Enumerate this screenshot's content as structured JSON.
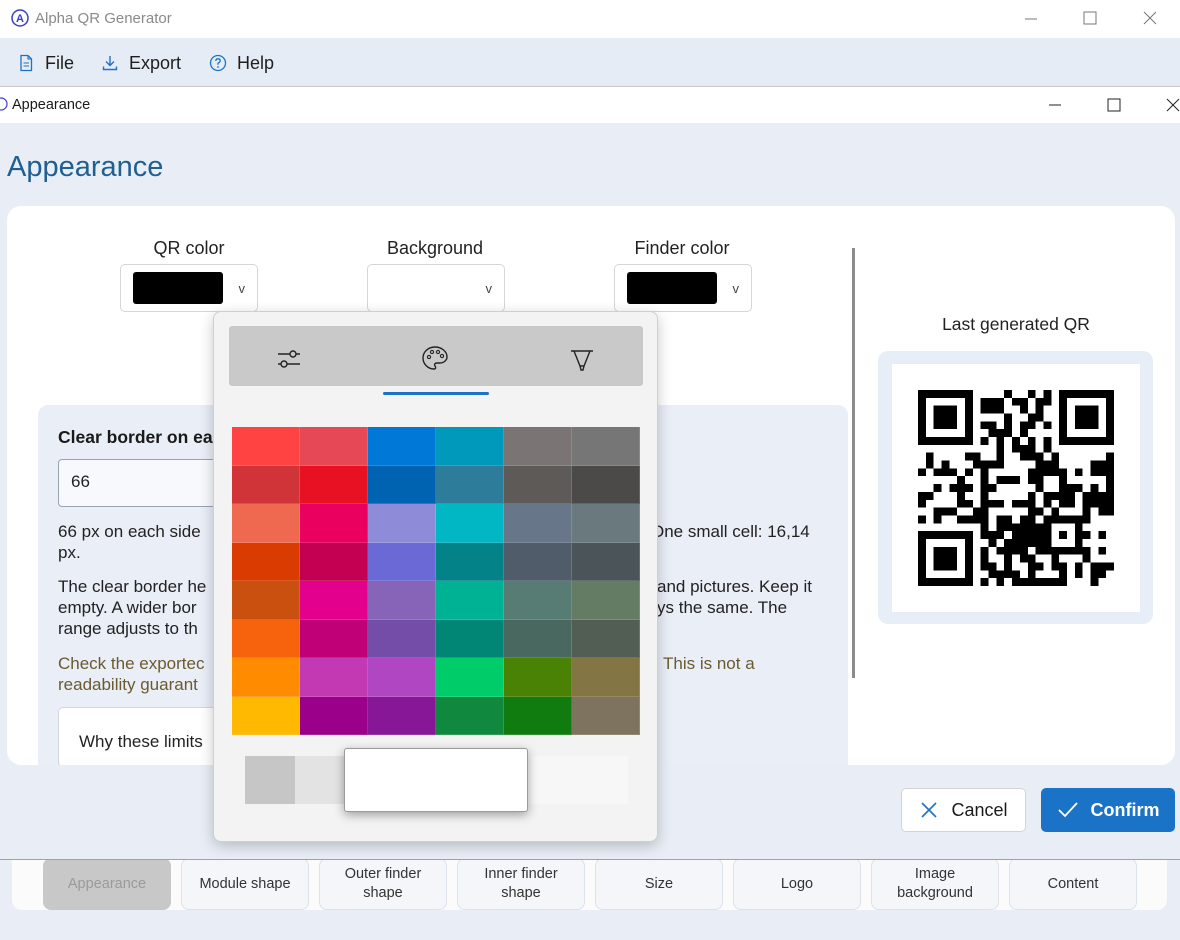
{
  "app": {
    "title": "Alpha QR Generator",
    "logo_icon": "alpha-logo-icon"
  },
  "menu": [
    {
      "label": "File",
      "icon": "file-icon"
    },
    {
      "label": "Export",
      "icon": "download-icon"
    },
    {
      "label": "Help",
      "icon": "help-icon"
    }
  ],
  "dialog": {
    "title": "Appearance",
    "heading": "Appearance",
    "pickers": {
      "qr_color": {
        "label": "QR color",
        "color": "#000000"
      },
      "background": {
        "label": "Background",
        "color": "#ffffff"
      },
      "finder_color": {
        "label": "Finder color",
        "color": "#000000"
      }
    },
    "preview": {
      "label": "Last generated QR"
    },
    "clear_border": {
      "title": "Clear border on ea",
      "value": "66",
      "line1_left": "66 px on each side",
      "line1_right": "One small cell: 16,14",
      "line1_cont": "px.",
      "para2_l1": "The clear border he",
      "para2_l2": "empty. A wider bor",
      "para2_l3": "range adjusts to th",
      "para2_r1": "and pictures. Keep it",
      "para2_r2": "ys the same. The",
      "warn_l1": "Check the exportec",
      "warn_l2": "readability guarant",
      "warn_r1": "This is not a",
      "why_label": "Why these limits"
    },
    "cancel_label": "Cancel",
    "confirm_label": "Confirm"
  },
  "color_flyout": {
    "tabs": [
      "sliders-icon",
      "palette-icon",
      "eyedropper-icon"
    ],
    "active_tab": "palette-icon",
    "palette": [
      [
        "#ff4343",
        "#e74856",
        "#0078d7",
        "#0099bc",
        "#7a7574",
        "#767676"
      ],
      [
        "#d13438",
        "#e81123",
        "#0063b1",
        "#2d7d9a",
        "#5d5a58",
        "#4c4a48"
      ],
      [
        "#ef6950",
        "#ea005e",
        "#8e8cd8",
        "#00b7c3",
        "#68768a",
        "#69797e"
      ],
      [
        "#da3b01",
        "#c30052",
        "#6b69d6",
        "#038387",
        "#515c6b",
        "#4a5459"
      ],
      [
        "#ca5010",
        "#e3008c",
        "#8764b8",
        "#00b294",
        "#567c73",
        "#647c64"
      ],
      [
        "#f7630c",
        "#bf0077",
        "#744da9",
        "#018574",
        "#486860",
        "#525e54"
      ],
      [
        "#ff8c00",
        "#c239b3",
        "#b146c2",
        "#00cc6a",
        "#498205",
        "#847545"
      ],
      [
        "#ffb900",
        "#9a0089",
        "#881798",
        "#10893e",
        "#107c10",
        "#7e735f"
      ]
    ],
    "recent_colors": [
      "#c6c6c6",
      "#e3e3e3",
      "#ffffff",
      "#f7f7f7"
    ],
    "selected_color": "#ffffff"
  },
  "bottom_tabs": [
    {
      "label": "Appearance",
      "active": true
    },
    {
      "label": "Module shape"
    },
    {
      "label": "Outer finder shape"
    },
    {
      "label": "Inner finder shape"
    },
    {
      "label": "Size"
    },
    {
      "label": "Logo"
    },
    {
      "label": "Image background"
    },
    {
      "label": "Content"
    }
  ]
}
